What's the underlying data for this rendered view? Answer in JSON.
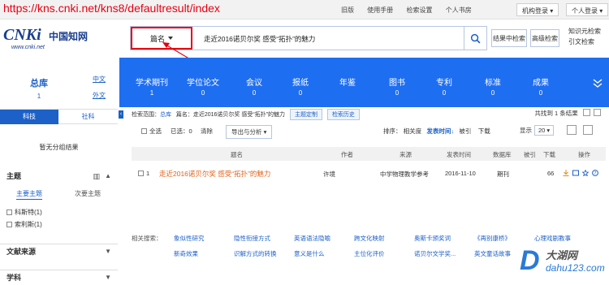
{
  "topbar": {
    "url": "https://kns.cnki.net/kns8/defaultresult/index",
    "links": [
      "旧版",
      "使用手册",
      "检索设置",
      "个人书房"
    ],
    "org_login": "机构登录",
    "personal_login": "个人登录"
  },
  "header": {
    "logo_text": "CNKi",
    "logo_cn": "中国知网",
    "logo_url": "www.cnki.net",
    "search": {
      "field": "篇名",
      "query": "走近2016诺贝尔奖  感受“拓扑”的魅力"
    },
    "search_within_label": "结果中检索",
    "advanced_search_label": "高级检索",
    "right_links": [
      "知识元检索",
      "引文检索"
    ]
  },
  "categories": [
    {
      "name": "学术期刊",
      "count": "1"
    },
    {
      "name": "学位论文",
      "count": "0"
    },
    {
      "name": "会议",
      "count": "0"
    },
    {
      "name": "报纸",
      "count": "0"
    },
    {
      "name": "年鉴",
      "count": ""
    },
    {
      "name": "图书",
      "count": "0"
    },
    {
      "name": "专利",
      "count": "0"
    },
    {
      "name": "标准",
      "count": "0"
    },
    {
      "name": "成果",
      "count": "0"
    }
  ],
  "sidebar": {
    "total_label": "总库",
    "total_count": "1",
    "lang_cn": "中文",
    "lang_foreign": "外文",
    "tab_tech": "科技",
    "tab_social": "社科",
    "no_result": "暂无分组结果",
    "topic_label": "主题",
    "main_topic": "主要主题",
    "sub_topic": "次要主题",
    "topic_items": [
      "科斯特(1)",
      "索利斯(1)"
    ],
    "source_label": "文献来源",
    "subject_label": "学科"
  },
  "results": {
    "scope_prefix": "检索范围：",
    "scope_db": "总库",
    "scope_query": "篇名：走近2016诺贝尔奖 感受“拓扑”的魅力",
    "theme_btn": "主题定制",
    "history_btn": "检索历史",
    "found": "共找到 1 条结果",
    "select_all": "全选",
    "selected": "已选：0",
    "clear": "清除",
    "export": "导出与分析",
    "sort_label": "排序：",
    "sort_options": [
      "相关度",
      "发表时间",
      "被引",
      "下载"
    ],
    "show_label": "显示",
    "show_value": "20",
    "columns": [
      "题名",
      "作者",
      "来源",
      "发表时间",
      "数据库",
      "被引",
      "下载",
      "操作"
    ],
    "rows": [
      {
        "num": "1",
        "title": "走近2016诺贝尔奖 感受“拓扑”的魅力",
        "author": "许境",
        "source": "中学物理教学参考",
        "date": "2016-11-10",
        "db": "期刊",
        "cited": "",
        "downloads": "66"
      }
    ],
    "related_label": "相关搜索：",
    "related": [
      [
        "象似性研究",
        "隐性衔接方式",
        "英语语法隐喻",
        "跨文化映射",
        "奥斯卡颁奖词",
        "《再别康桥》",
        "心理戏剧教事"
      ],
      [
        "新奇效果",
        "识解方式的转换",
        "意义是什么",
        "主位化评价",
        "诺贝尔文学奖...",
        "英文童话故事",
        ""
      ]
    ]
  },
  "watermark": {
    "letter": "D",
    "top": "大湖网",
    "bottom": "dahu123.com"
  },
  "colors": {
    "accent": "#1e6ef2",
    "highlight": "#e60012",
    "link": "#1c60c8",
    "title": "#e0641d"
  }
}
